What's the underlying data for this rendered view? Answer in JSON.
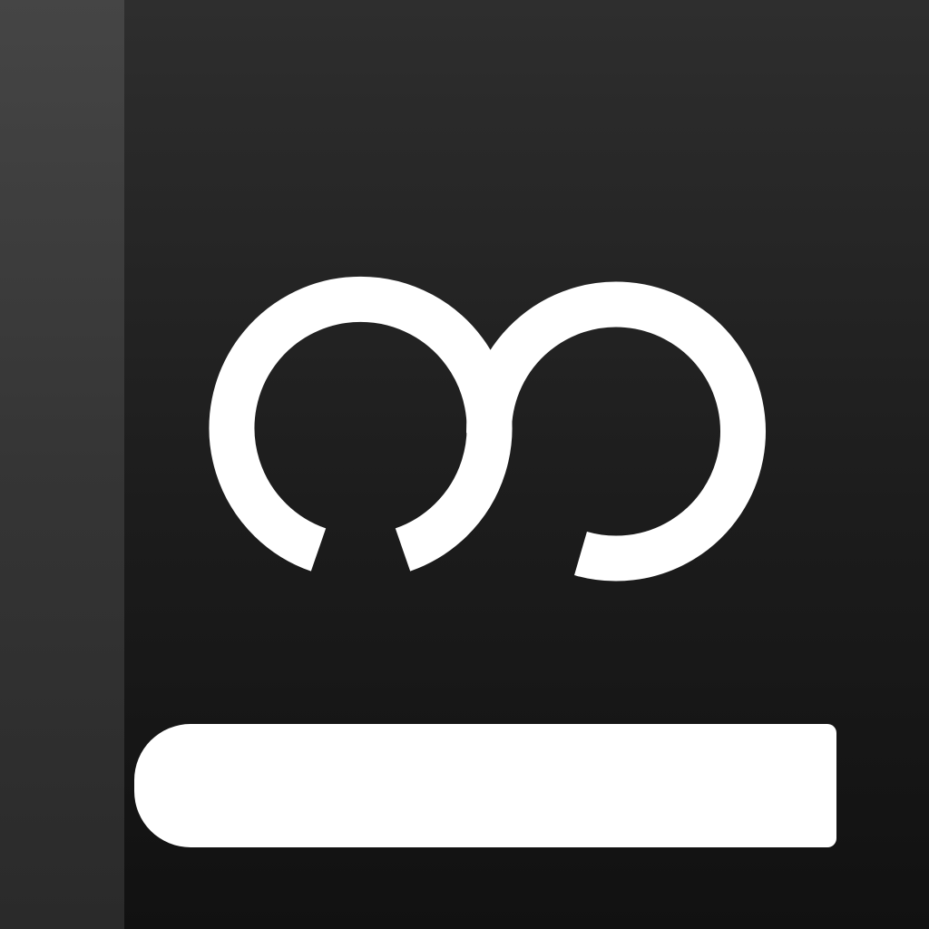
{
  "app_icon": {
    "logo_icon": "double-loop-logo-icon",
    "label_strip_text": "",
    "colors": {
      "background_top": "#2e2e2e",
      "background_bottom": "#111111",
      "spine": "#404040",
      "foreground": "#ffffff"
    }
  }
}
